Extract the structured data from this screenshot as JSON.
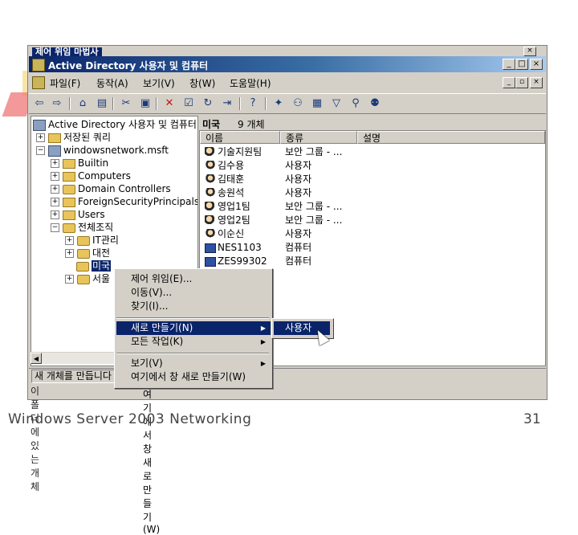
{
  "background_window": {
    "title": "제어 위임 마법사"
  },
  "window": {
    "title": "Active Directory 사용자 및 컴퓨터",
    "controls": [
      "_",
      "□",
      "×"
    ]
  },
  "menubar": {
    "items": [
      "파일(F)",
      "동작(A)",
      "보기(V)",
      "창(W)",
      "도움말(H)"
    ],
    "mdi_controls": [
      "_",
      "▫",
      "×"
    ]
  },
  "toolbar": {
    "icons": [
      "back-arrow-icon",
      "forward-arrow-icon",
      "up-folder-icon",
      "show-tree-icon",
      "cut-icon",
      "paste-icon",
      "delete-icon",
      "properties-icon",
      "refresh-icon",
      "export-icon",
      "help-icon",
      "new-user-icon",
      "new-group-icon",
      "new-ou-icon",
      "filter-icon",
      "find-icon",
      "add-group-icon"
    ]
  },
  "tree": {
    "root": "Active Directory 사용자 및 컴퓨터",
    "saved_queries": "저장된 쿼리",
    "domain": "windowsnetwork.msft",
    "children": [
      "Builtin",
      "Computers",
      "Domain Controllers",
      "ForeignSecurityPrincipals",
      "Users"
    ],
    "ou_root": "전체조직",
    "ou_children": [
      "IT관리",
      "대전",
      "미국",
      "서울"
    ]
  },
  "right_pane": {
    "location": "미국",
    "count": "9 개체",
    "columns": [
      "이름",
      "종류",
      "설명"
    ],
    "rows": [
      {
        "name": "기술지원팀",
        "type": "보안 그룹 - ...",
        "icon": "group"
      },
      {
        "name": "김수용",
        "type": "사용자",
        "icon": "user"
      },
      {
        "name": "김태훈",
        "type": "사용자",
        "icon": "user"
      },
      {
        "name": "송원석",
        "type": "사용자",
        "icon": "user"
      },
      {
        "name": "영업1팀",
        "type": "보안 그룹 - ...",
        "icon": "group"
      },
      {
        "name": "영업2팀",
        "type": "보안 그룹 - ...",
        "icon": "group"
      },
      {
        "name": "이순신",
        "type": "사용자",
        "icon": "user"
      },
      {
        "name": "NES1103",
        "type": "컴퓨터",
        "icon": "computer"
      },
      {
        "name": "ZES99302",
        "type": "컴퓨터",
        "icon": "computer"
      }
    ]
  },
  "status": {
    "text": "새 개체를 만듭니다"
  },
  "context_menu": {
    "items": [
      "제어 위임(E)...",
      "이동(V)...",
      "찾기(I)...",
      "새로 만들기(N)",
      "모든 작업(K)",
      "보기(V)",
      "여기에서 창 새로 만들기(W)"
    ],
    "highlighted": "새로 만들기(N)"
  },
  "submenu": {
    "item": "사용자"
  },
  "hover_tooltip": "여기에서 창 새로 만들기(W)",
  "behind_text": "이 폴더에 있는 개체",
  "footer": {
    "left": "Windows Server 2003 Networking",
    "page": "31"
  },
  "colors": {
    "title_active": "#0a246a",
    "face": "#d4d0c8",
    "highlight": "#0a246a"
  }
}
